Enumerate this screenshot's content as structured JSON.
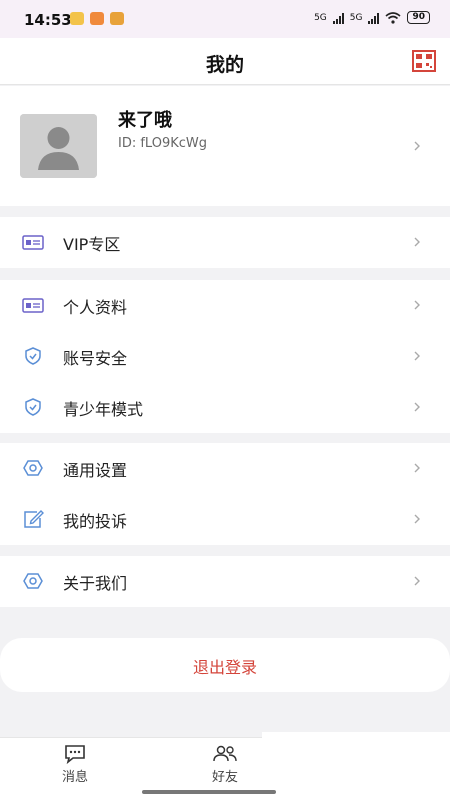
{
  "status_bar": {
    "time": "14:53",
    "battery": "90",
    "network": "5G"
  },
  "header": {
    "title": "我的"
  },
  "profile": {
    "name": "来了哦",
    "id_text": "ID: fLO9KcWg"
  },
  "groups": [
    {
      "items": [
        {
          "label": "VIP专区",
          "icon": "id-card-icon"
        }
      ]
    },
    {
      "items": [
        {
          "label": "个人资料",
          "icon": "id-card-icon"
        },
        {
          "label": "账号安全",
          "icon": "shield-icon"
        },
        {
          "label": "青少年模式",
          "icon": "shield-icon"
        }
      ]
    },
    {
      "items": [
        {
          "label": "通用设置",
          "icon": "gear-icon"
        },
        {
          "label": "我的投诉",
          "icon": "edit-icon"
        }
      ]
    },
    {
      "items": [
        {
          "label": "关于我们",
          "icon": "gear-icon"
        }
      ]
    }
  ],
  "logout": {
    "label": "退出登录"
  },
  "bottom_nav": [
    {
      "label": "消息",
      "icon": "chat-icon"
    },
    {
      "label": "好友",
      "icon": "friends-icon"
    }
  ],
  "colors": {
    "accent": "#d4453b",
    "icon_blue": "#5b8fd6",
    "icon_purple": "#6b62c9"
  }
}
